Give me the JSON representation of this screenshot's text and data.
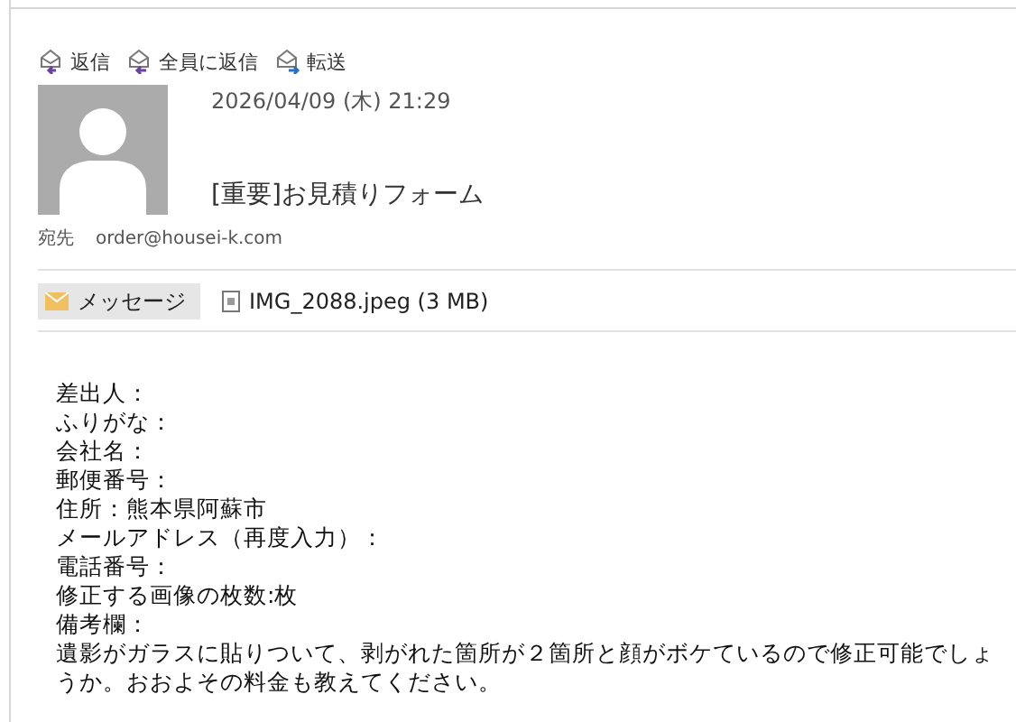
{
  "toolbar": [
    {
      "label": "返信",
      "kind": "reply"
    },
    {
      "label": "全員に返信",
      "kind": "reply_all"
    },
    {
      "label": "転送",
      "kind": "forward"
    }
  ],
  "message": {
    "date": "2026/04/09 (木) 21:29",
    "subject": "[重要]お見積りフォーム",
    "to_label": "宛先",
    "to": "order@housei-k.com"
  },
  "attachments": [
    {
      "label": "メッセージ",
      "kind": "message",
      "selected": true
    },
    {
      "label": "IMG_2088.jpeg (3 MB)",
      "kind": "file",
      "selected": false
    }
  ],
  "body": [
    "差出人：",
    "ふりがな：",
    "会社名：",
    "郵便番号：",
    "住所：熊本県阿蘇市",
    "メールアドレス（再度入力）：",
    "電話番号：",
    "修正する画像の枚数:枚",
    "備考欄：",
    "遺影がガラスに貼りついて、剥がれた箇所が２箇所と顔がボケているので修正可能でしょうか。おおよその料金も教えてください。"
  ]
}
